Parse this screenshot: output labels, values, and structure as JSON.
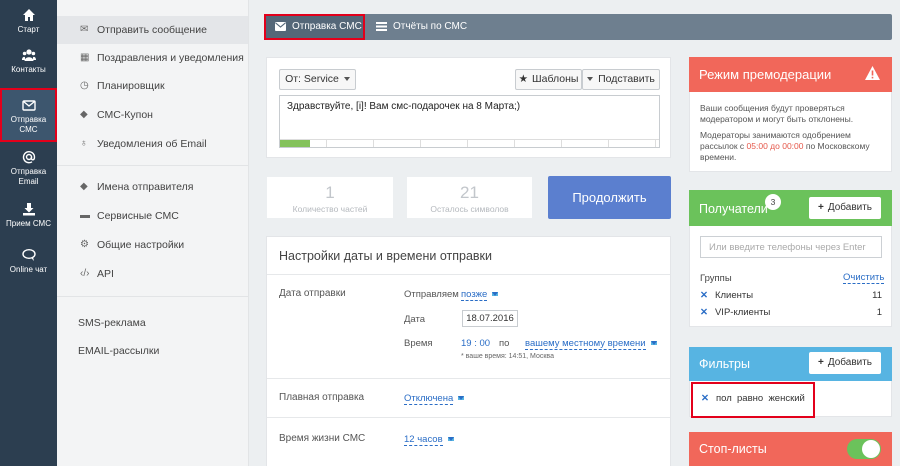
{
  "nav": [
    {
      "label": "Старт",
      "icon": "home-icon"
    },
    {
      "label": "Контакты",
      "icon": "contacts-icon"
    },
    {
      "label": "Отправка СМС",
      "icon": "envelope-icon"
    },
    {
      "label": "Отправка Email",
      "icon": "at-icon"
    },
    {
      "label": "Прием СМС",
      "icon": "download-icon"
    },
    {
      "label": "Online чат",
      "icon": "chat-icon"
    }
  ],
  "submenu": {
    "items": [
      {
        "label": "Отправить сообщение",
        "icon": "envelope-icon"
      },
      {
        "label": "Поздравления и уведомления",
        "icon": "calendar-icon"
      },
      {
        "label": "Планировщик",
        "icon": "clock-icon"
      },
      {
        "label": "СМС-Купон",
        "icon": "tag-icon"
      },
      {
        "label": "Уведомления об Email",
        "icon": "bulb-icon"
      },
      {
        "label": "Имена отправителя",
        "icon": "tags-icon"
      },
      {
        "label": "Сервисные СМС",
        "icon": "truck-icon"
      },
      {
        "label": "Общие настройки",
        "icon": "gear-icon"
      },
      {
        "label": "API",
        "icon": "code-icon"
      }
    ],
    "sms_ads": "SMS-реклама",
    "email_mailing": "EMAIL-рассылки"
  },
  "tabs": {
    "send_sms": "Отправка СМС",
    "sms_reports": "Отчёты по СМС"
  },
  "composer": {
    "from_label": "От: Service",
    "templates_label": "Шаблоны",
    "insert_label": "Подставить",
    "message": "Здравствуйте, [i]! Вам смс-подарочек на 8 Марта;)",
    "progress": 0.08
  },
  "stats": {
    "parts_value": "1",
    "parts_label": "Количество частей",
    "chars_value": "21",
    "chars_label": "Осталось символов",
    "continue_label": "Продолжить"
  },
  "settings": {
    "title": "Настройки даты и времени отправки",
    "send_date_label": "Дата отправки",
    "sending_label": "Отправляем",
    "sending_value": "позже",
    "date_label": "Дата",
    "date_value": "18.07.2016",
    "time_label": "Время",
    "time_value": "19 : 00",
    "time_by": "по",
    "time_zone": "вашему местному времени",
    "time_note": "* ваше время: 14:51, Москва",
    "smooth_label": "Плавная отправка",
    "smooth_value": "Отключена",
    "lifetime_label": "Время жизни СМС",
    "lifetime_value": "12 часов"
  },
  "premoderation": {
    "title": "Режим премодерации",
    "text1": "Ваши сообщения будут проверяться модератором и могут быть отклонены.",
    "text2_a": "Модераторы занимаются одобрением рассылок с ",
    "text2_hours": "05:00 до 00:00",
    "text2_b": " по Московскому времени."
  },
  "recipients": {
    "title": "Получатели",
    "count": "3",
    "add_label": "Добавить",
    "phone_placeholder": "Или введите телефоны через Enter",
    "groups_label": "Группы",
    "clear_label": "Очистить",
    "groups": [
      {
        "name": "Клиенты",
        "count": "11"
      },
      {
        "name": "VIP-клиенты",
        "count": "1"
      }
    ]
  },
  "filters": {
    "title": "Фильтры",
    "add_label": "Добавить",
    "filter_field": "пол",
    "filter_op": "равно",
    "filter_value": "женский"
  },
  "stoplists": {
    "title": "Стоп-листы",
    "enabled": true
  },
  "colors": {
    "accent": "#5b7fcf",
    "green": "#6bc25b",
    "red": "#f1675a",
    "blue": "#57b4e2",
    "highlight": "#e3001b"
  }
}
